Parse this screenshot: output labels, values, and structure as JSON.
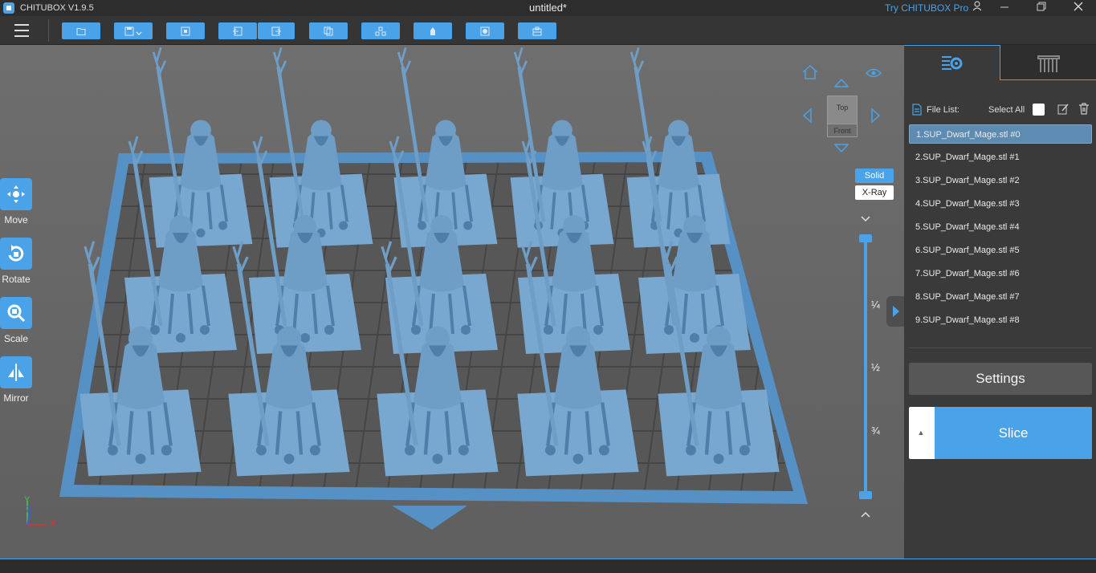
{
  "titlebar": {
    "app_name": "CHITUBOX V1.9.5",
    "doc_title": "untitled*",
    "try_pro": "Try CHITUBOX Pro"
  },
  "toolbar": {
    "buttons": [
      {
        "name": "open-file-icon"
      },
      {
        "name": "save-icon"
      },
      {
        "name": "load-model-icon"
      },
      {
        "name": "undo-icon"
      },
      {
        "name": "redo-icon"
      },
      {
        "name": "clone-icon"
      },
      {
        "name": "auto-layout-icon"
      },
      {
        "name": "support-icon"
      },
      {
        "name": "hollow-icon"
      },
      {
        "name": "print-plate-icon"
      }
    ]
  },
  "left_tools": [
    {
      "label": "Move",
      "icon": "move-icon"
    },
    {
      "label": "Rotate",
      "icon": "rotate-icon"
    },
    {
      "label": "Scale",
      "icon": "scale-icon"
    },
    {
      "label": "Mirror",
      "icon": "mirror-icon"
    }
  ],
  "viewcube": {
    "top": "Top",
    "front": "Front"
  },
  "render_mode": {
    "solid": "Solid",
    "xray": "X-Ray",
    "active": "Solid"
  },
  "layer_slider": {
    "ticks": [
      "¼",
      "½",
      "¾"
    ]
  },
  "axes": {
    "x": "X",
    "y": "Y",
    "z": "Z"
  },
  "panel": {
    "file_list_label": "File List:",
    "select_all_label": "Select All",
    "files": [
      "1.SUP_Dwarf_Mage.stl #0",
      "2.SUP_Dwarf_Mage.stl #1",
      "3.SUP_Dwarf_Mage.stl #2",
      "4.SUP_Dwarf_Mage.stl #3",
      "5.SUP_Dwarf_Mage.stl #4",
      "6.SUP_Dwarf_Mage.stl #5",
      "7.SUP_Dwarf_Mage.stl #6",
      "8.SUP_Dwarf_Mage.stl #7",
      "9.SUP_Dwarf_Mage.stl #8"
    ],
    "selected_index": 0,
    "settings_label": "Settings",
    "slice_label": "Slice",
    "slice_drop": "▲"
  },
  "colors": {
    "accent": "#4aa3e8",
    "viewport": "#666666",
    "model": "#6e9dc6",
    "plate_grid": "#5b5b5b"
  }
}
